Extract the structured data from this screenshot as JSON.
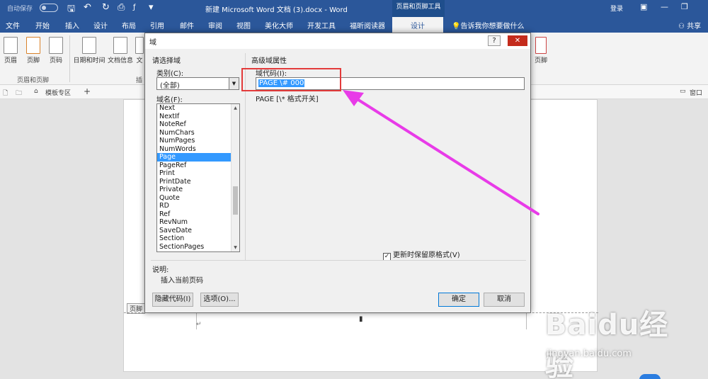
{
  "titlebar": {
    "autosave": "自动保存",
    "autosave_state": "关",
    "doc_title": "新建 Microsoft Word 文档 (3).docx - Word",
    "context_tools": "页眉和页脚工具",
    "login": "登录"
  },
  "tabs": [
    "文件",
    "开始",
    "插入",
    "设计",
    "布局",
    "引用",
    "邮件",
    "审阅",
    "视图",
    "美化大师",
    "开发工具",
    "福昕阅读器"
  ],
  "active_tab": "设计",
  "tell_me": "告诉我你想要做什么",
  "share": "共享",
  "ribbon": {
    "buttons": [
      "页眉",
      "页脚",
      "页码",
      "日期和时间",
      "文档信息",
      "文"
    ],
    "group_header_footer": "页眉和页脚",
    "group_insert_partial": "插",
    "right_partial": "页脚"
  },
  "docstrip": {
    "template_zone": "模板专区",
    "window_partial": "窗口"
  },
  "document": {
    "footer_tag": "页脚"
  },
  "dialog": {
    "title": "域",
    "help": "?",
    "close": "✕",
    "choose_field": "请选择域",
    "category_label": "类别(C):",
    "category_value": "(全部)",
    "field_names_label": "域名(F):",
    "field_names": [
      "Next",
      "NextIf",
      "NoteRef",
      "NumChars",
      "NumPages",
      "NumWords",
      "Page",
      "PageRef",
      "Print",
      "PrintDate",
      "Private",
      "Quote",
      "RD",
      "Ref",
      "RevNum",
      "SaveDate",
      "Section",
      "SectionPages"
    ],
    "selected_field": "Page",
    "advanced_props": "高级域属性",
    "field_code_label": "域代码(I):",
    "field_code_value": "PAGE  \\# 000",
    "syntax": "PAGE [\\* 格式开关]",
    "preserve_format": "更新时保留原格式(V)",
    "preserve_checked": true,
    "description_label": "说明:",
    "description_text": "插入当前页码",
    "hide_codes_button": "隐藏代码(I)",
    "options_button": "选项(O)...",
    "ok_button": "确定",
    "cancel_button": "取消"
  },
  "annotation": {
    "highlight_color": "#e33b3b",
    "arrow_color": "#e83be8"
  },
  "watermark": {
    "brand": "Baidu经验",
    "url": "jingyan.baidu.com"
  },
  "colors": {
    "word_blue": "#2b579a",
    "selection": "#3399ff",
    "close_red": "#c42b1c"
  }
}
